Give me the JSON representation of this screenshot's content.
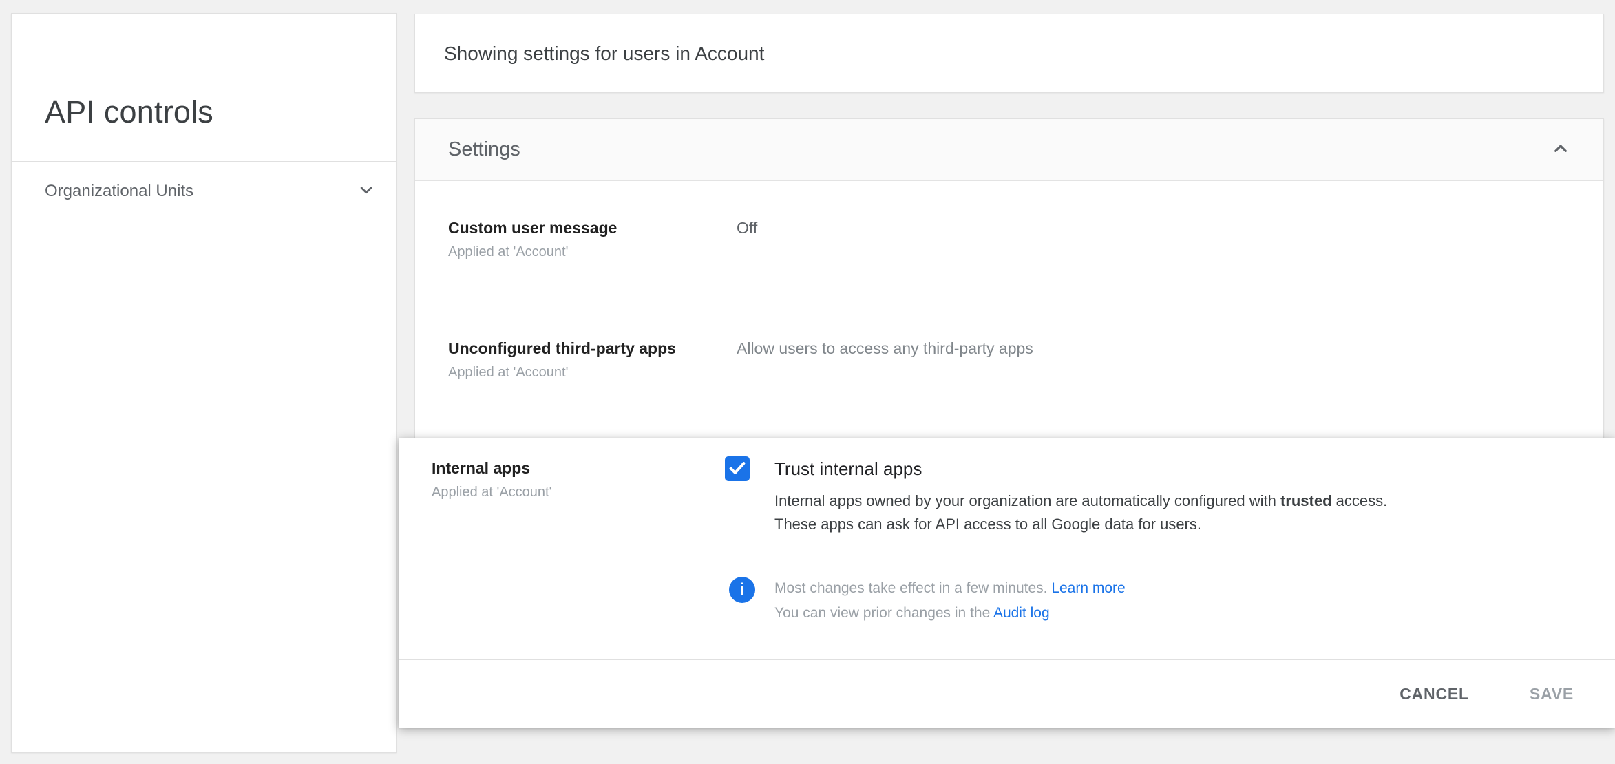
{
  "sidebar": {
    "title": "API controls",
    "nav": [
      {
        "label": "Organizational Units"
      }
    ]
  },
  "topbar": {
    "scope_text": "Showing settings for users in Account"
  },
  "settings": {
    "title": "Settings",
    "rows": [
      {
        "name": "Custom user message",
        "applied_at": "Applied at 'Account'",
        "value": "Off"
      },
      {
        "name": "Unconfigured third-party apps",
        "applied_at": "Applied at 'Account'",
        "value": "Allow users to access any third-party apps"
      }
    ]
  },
  "dialog": {
    "name": "Internal apps",
    "applied_at": "Applied at 'Account'",
    "checkbox_checked": true,
    "checkbox_label": "Trust internal apps",
    "description": {
      "line1_before": "Internal apps owned by your organization are automatically configured with ",
      "line1_bold": "trusted",
      "line1_after": " access.",
      "line2": "These apps can ask for API access to all Google data for users."
    },
    "note": {
      "icon_glyph": "i",
      "line1_text": "Most changes take effect in a few minutes. ",
      "line1_link": "Learn more",
      "line2_text": "You can view prior changes in the ",
      "line2_link": "Audit log"
    },
    "actions": {
      "cancel": "CANCEL",
      "save": "SAVE"
    }
  },
  "colors": {
    "accent_blue": "#1a73e8",
    "page_background": "#f1f1f1",
    "card_border": "#e0e0e0",
    "disabled_button": "#9aa0a6"
  }
}
